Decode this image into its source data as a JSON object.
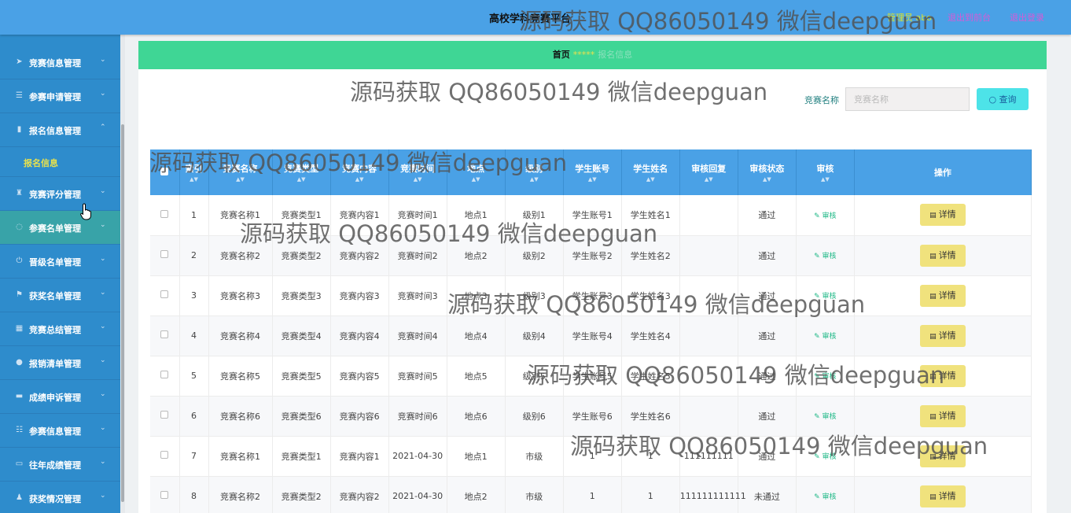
{
  "header": {
    "title": "高校学科竞赛平台",
    "user": "管理员 abo",
    "to_front": "退出到前台",
    "logout": "退出登录"
  },
  "sidebar": {
    "items": [
      {
        "label": "竞赛信息管理",
        "icon": "send-icon"
      },
      {
        "label": "参赛申请管理",
        "icon": "list-icon"
      },
      {
        "label": "报名信息管理",
        "icon": "bar-chart-icon"
      },
      {
        "label": "竞赛评分管理",
        "icon": "trophy-icon"
      },
      {
        "label": "参赛名单管理",
        "icon": "refresh-icon"
      },
      {
        "label": "晋级名单管理",
        "icon": "power-icon"
      },
      {
        "label": "获奖名单管理",
        "icon": "flag-icon"
      },
      {
        "label": "竞赛总结管理",
        "icon": "calendar-icon"
      },
      {
        "label": "报销清单管理",
        "icon": "location-icon"
      },
      {
        "label": "成绩申诉管理",
        "icon": "chat-icon"
      },
      {
        "label": "参赛信息管理",
        "icon": "sliders-icon"
      },
      {
        "label": "往年成绩管理",
        "icon": "message-icon"
      },
      {
        "label": "获奖情况管理",
        "icon": "user-icon"
      }
    ],
    "submenu": {
      "label": "报名信息"
    }
  },
  "breadcrumb": {
    "home": "首页",
    "separator": "*****",
    "current": "报名信息"
  },
  "search": {
    "label": "竞赛名称",
    "placeholder": "竞赛名称",
    "button": "查询"
  },
  "table": {
    "columns": [
      "索引",
      "竞赛名称",
      "竞赛类型",
      "竞赛内容",
      "竞赛时间",
      "地点",
      "级别",
      "学生账号",
      "学生姓名",
      "审核回复",
      "审核状态",
      "审核",
      "操作"
    ],
    "audit_label": "审核",
    "detail_label": "详情",
    "rows": [
      [
        "1",
        "竞赛名称1",
        "竞赛类型1",
        "竞赛内容1",
        "竞赛时间1",
        "地点1",
        "级别1",
        "学生账号1",
        "学生姓名1",
        "",
        "通过"
      ],
      [
        "2",
        "竞赛名称2",
        "竞赛类型2",
        "竞赛内容2",
        "竞赛时间2",
        "地点2",
        "级别2",
        "学生账号2",
        "学生姓名2",
        "",
        "通过"
      ],
      [
        "3",
        "竞赛名称3",
        "竞赛类型3",
        "竞赛内容3",
        "竞赛时间3",
        "地点3",
        "级别3",
        "学生账号3",
        "学生姓名3",
        "",
        "通过"
      ],
      [
        "4",
        "竞赛名称4",
        "竞赛类型4",
        "竞赛内容4",
        "竞赛时间4",
        "地点4",
        "级别4",
        "学生账号4",
        "学生姓名4",
        "",
        "通过"
      ],
      [
        "5",
        "竞赛名称5",
        "竞赛类型5",
        "竞赛内容5",
        "竞赛时间5",
        "地点5",
        "级别5",
        "学生账号5",
        "学生姓名5",
        "",
        "通过"
      ],
      [
        "6",
        "竞赛名称6",
        "竞赛类型6",
        "竞赛内容6",
        "竞赛时间6",
        "地点6",
        "级别6",
        "学生账号6",
        "学生姓名6",
        "",
        "通过"
      ],
      [
        "7",
        "竞赛名称1",
        "竞赛类型1",
        "竞赛内容1",
        "2021-04-30",
        "地点1",
        "市级",
        "1",
        "1",
        "111111111",
        "通过"
      ],
      [
        "8",
        "竞赛名称2",
        "竞赛类型2",
        "竞赛内容2",
        "2021-04-30",
        "地点2",
        "市级",
        "1",
        "1",
        "111111111111",
        "未通过"
      ]
    ]
  },
  "watermark": "源码获取 QQ86050149 微信deepguan",
  "colors": {
    "header": "#4aa1e6",
    "sidebar": "#2e8ccc",
    "breadcrumb": "#3fd695",
    "accent": "#4de3e8",
    "detail": "#f0e27d"
  }
}
